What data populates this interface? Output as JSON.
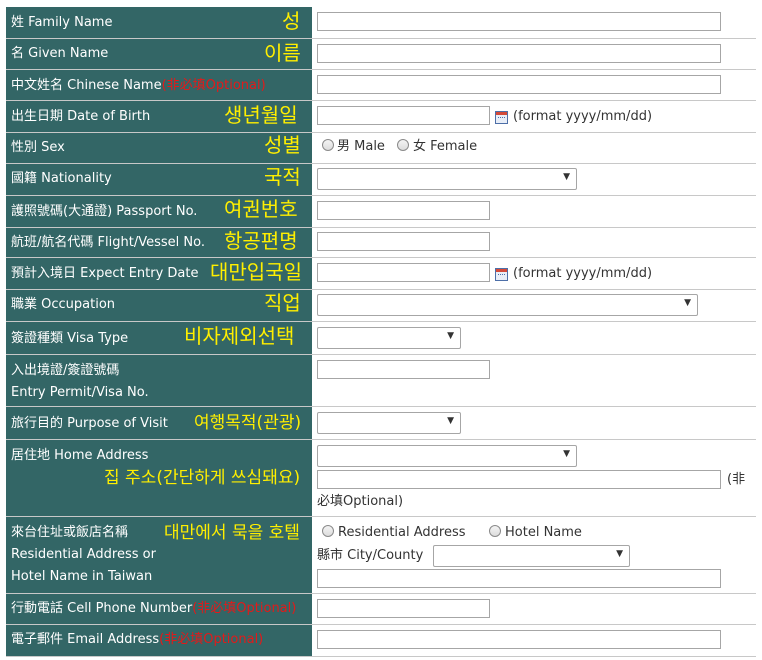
{
  "rows": {
    "family_name": {
      "zh": "姓",
      "en": "Family Name",
      "ko": "성"
    },
    "given_name": {
      "zh": "名",
      "en": "Given Name",
      "ko": "이름"
    },
    "chinese_name": {
      "zh": "中文姓名",
      "en": "Chinese Name",
      "optional": "(非必填Optional)"
    },
    "dob": {
      "zh": "出生日期",
      "en": "Date of Birth",
      "ko": "생년월일",
      "format_hint": "(format yyyy/mm/dd)"
    },
    "sex": {
      "zh": "性別",
      "en": "Sex",
      "ko": "성별",
      "male_label": "男 Male",
      "female_label": "女 Female"
    },
    "nationality": {
      "zh": "國籍",
      "en": "Nationality",
      "ko": "국적"
    },
    "passport": {
      "zh": "護照號碼(大通證)",
      "en": "Passport No.",
      "ko": "여권번호"
    },
    "flight": {
      "zh": "航班/航名代碼",
      "en": "Flight/Vessel No.",
      "ko": "항공편명"
    },
    "entry_date": {
      "zh": "預計入境日",
      "en": "Expect Entry Date",
      "ko": "대만입국일",
      "format_hint": "(format yyyy/mm/dd)"
    },
    "occupation": {
      "zh": "職業",
      "en": "Occupation",
      "ko": "직업"
    },
    "visa_type": {
      "zh": "簽證種類",
      "en": "Visa Type",
      "ko": "비자제외선택"
    },
    "entry_permit": {
      "line1": "入出境證/簽證號碼",
      "line2": "Entry Permit/Visa No."
    },
    "purpose": {
      "zh": "旅行目的",
      "en": "Purpose of Visit",
      "ko": "여행목적(관광)"
    },
    "home_address": {
      "zh": "居住地",
      "en": "Home Address",
      "ko": "집 주소(간단하게 쓰심돼요)",
      "optional_part1": "(非",
      "optional_part2": "必填Optional)"
    },
    "residential": {
      "zh": "來台住址或飯店名稱",
      "en_line1": "Residential Address or",
      "en_line2": "Hotel Name in Taiwan",
      "ko": "대만에서 묵을 호텔",
      "radio_residential": "Residential Address",
      "radio_hotel": "Hotel Name",
      "city_label": "縣市 City/County"
    },
    "phone": {
      "zh": "行動電話",
      "en": "Cell Phone Number",
      "optional": "(非必填Optional)"
    },
    "email": {
      "zh": "電子郵件",
      "en": "Email Address",
      "optional": "(非必填Optional)"
    }
  },
  "colors": {
    "label_bg": "#336666",
    "korean_annotation": "#ffef00",
    "optional_text": "#e21a1a"
  }
}
